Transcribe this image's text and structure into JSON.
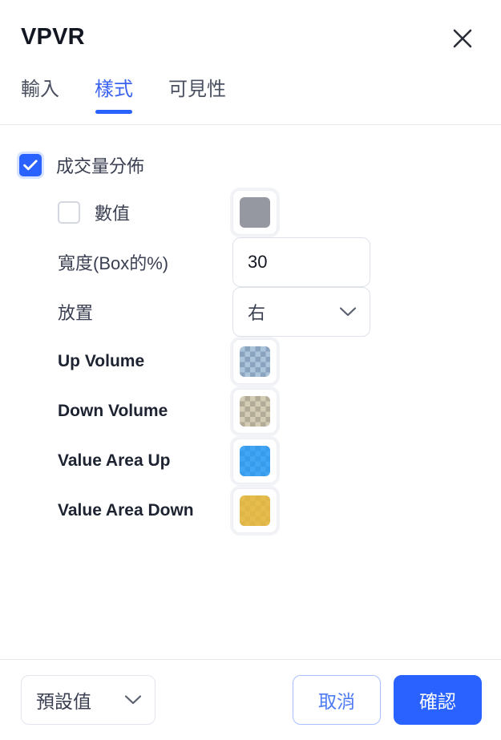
{
  "dialog": {
    "title": "VPVR",
    "close_icon": "close-icon"
  },
  "tabs": [
    {
      "label": "輸入",
      "active": false
    },
    {
      "label": "樣式",
      "active": true
    },
    {
      "label": "可見性",
      "active": false
    }
  ],
  "settings": {
    "volume_profile": {
      "label": "成交量分佈",
      "checked": true
    },
    "values": {
      "label": "數值",
      "checked": false,
      "swatch_color": "#9598a1",
      "swatch_opaque": true
    },
    "width": {
      "label": "寬度(Box的%)",
      "value": "30"
    },
    "placement": {
      "label": "放置",
      "value": "右",
      "chevron_icon": "chevron-down-icon"
    },
    "colors": [
      {
        "label": "Up Volume",
        "color": "#5b8cb8",
        "opacity": 0.5
      },
      {
        "label": "Down Volume",
        "color": "#a99a6a",
        "opacity": 0.5
      },
      {
        "label": "Value Area Up",
        "color": "#2196f3",
        "opacity": 0.85
      },
      {
        "label": "Value Area Down",
        "color": "#e3b53a",
        "opacity": 0.9
      }
    ]
  },
  "footer": {
    "preset": {
      "label": "預設值",
      "chevron_icon": "chevron-down-icon"
    },
    "cancel_label": "取消",
    "confirm_label": "確認"
  },
  "theme": {
    "accent": "#2962ff",
    "text": "#131722",
    "muted": "#4a5060",
    "border": "#dfe2ea"
  }
}
